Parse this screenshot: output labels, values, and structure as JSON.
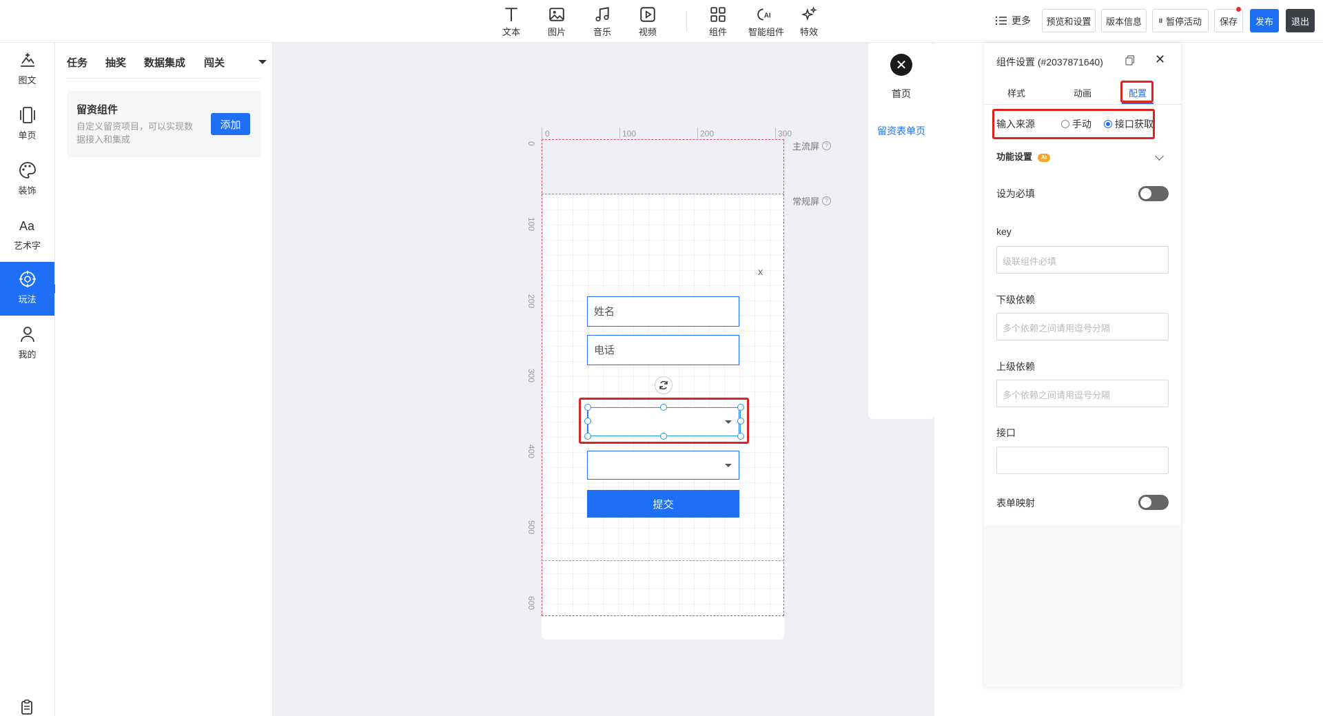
{
  "toolbar": {
    "tools": [
      {
        "label": "文本",
        "icon": "text-icon"
      },
      {
        "label": "图片",
        "icon": "image-icon"
      },
      {
        "label": "音乐",
        "icon": "music-icon"
      },
      {
        "label": "视频",
        "icon": "video-icon"
      },
      {
        "label": "组件",
        "icon": "components-icon"
      },
      {
        "label": "智能组件",
        "icon": "ai-component-icon"
      },
      {
        "label": "特效",
        "icon": "sparkle-icon"
      }
    ],
    "more": "更多",
    "preview": "预览和设置",
    "version": "版本信息",
    "pause": "暂停活动",
    "pause_glyph": "II",
    "save": "保存",
    "publish": "发布",
    "exit": "退出"
  },
  "leftnav": {
    "items": [
      {
        "label": "图文",
        "icon": "image-text-icon"
      },
      {
        "label": "单页",
        "icon": "single-page-icon"
      },
      {
        "label": "装饰",
        "icon": "palette-icon"
      },
      {
        "label": "艺术字",
        "icon": "art-text-icon"
      },
      {
        "label": "玩法",
        "icon": "gameplay-icon",
        "active": true
      },
      {
        "label": "我的",
        "icon": "user-icon"
      }
    ],
    "art_glyph": "Aa"
  },
  "lpanel": {
    "tabs": [
      "任务",
      "抽奖",
      "数据集成",
      "闯关"
    ],
    "card": {
      "title": "留资组件",
      "desc": "自定义留资项目，可以实现数据接入和集成",
      "button": "添加"
    }
  },
  "canvas": {
    "ruler_h": [
      "0",
      "100",
      "200",
      "300"
    ],
    "ruler_v": [
      "0",
      "100",
      "200",
      "300",
      "400",
      "500",
      "600"
    ],
    "main_screen": "主流屏",
    "normal_screen": "常规屏",
    "help_glyph": "?",
    "form": {
      "close": "x",
      "name_placeholder": "姓名",
      "phone_placeholder": "电话",
      "submit": "提交"
    }
  },
  "pagepanel": {
    "close_glyph": "✕",
    "pages": [
      "首页",
      "留资表单页"
    ]
  },
  "rpanel": {
    "title": "组件设置 (#2037871640)",
    "close_glyph": "✕",
    "tabs": [
      "样式",
      "动画",
      "配置"
    ],
    "input_source_label": "输入来源",
    "radio_manual": "手动",
    "radio_api": "接口获取",
    "feature_settings": "功能设置",
    "feature_badge": "AI",
    "required_label": "设为必填",
    "key_label": "key",
    "key_placeholder": "级联组件必填",
    "lower_dep_label": "下级依赖",
    "lower_dep_placeholder": "多个依赖之间请用逗号分隔",
    "upper_dep_label": "上级依赖",
    "upper_dep_placeholder": "多个依赖之间请用逗号分隔",
    "api_label": "接口",
    "form_mapping_label": "表单映射"
  },
  "colors": {
    "accent": "#1e6ff5",
    "highlight": "#e12020"
  }
}
